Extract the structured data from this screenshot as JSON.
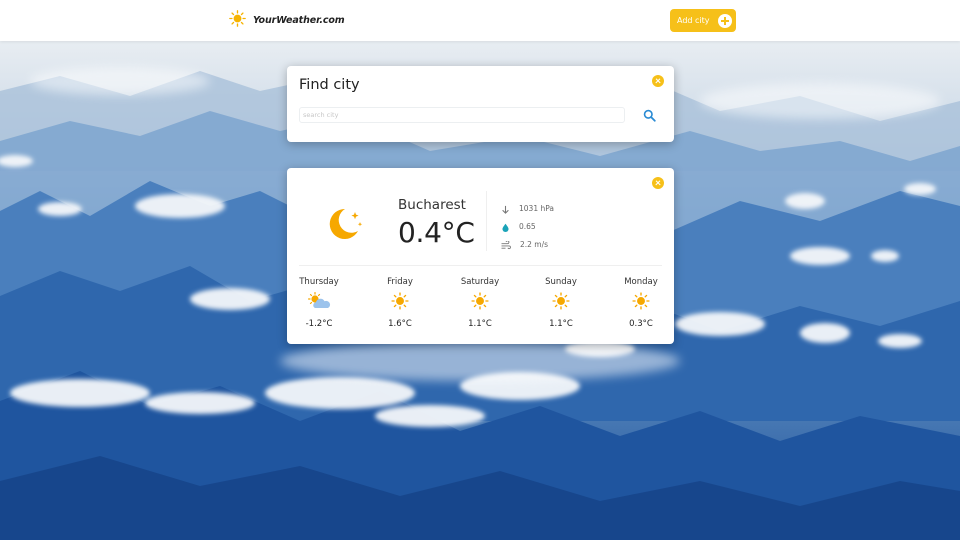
{
  "header": {
    "brand": "YourWeather.com",
    "add_city_label": "Add city",
    "brand_icon": "sun-icon"
  },
  "find_city": {
    "title": "Find city",
    "search_placeholder": "search city",
    "search_value": ""
  },
  "weather": {
    "city": "Bucharest",
    "temperature": "0.4°C",
    "condition_icon": "moon-stars-icon",
    "pressure": "1031 hPa",
    "humidity": "0.65",
    "wind": "2.2 m/s",
    "forecast": [
      {
        "day": "Thursday",
        "icon": "sun-cloud-icon",
        "temp": "-1.2°C"
      },
      {
        "day": "Friday",
        "icon": "sun-icon",
        "temp": "1.6°C"
      },
      {
        "day": "Saturday",
        "icon": "sun-icon",
        "temp": "1.1°C"
      },
      {
        "day": "Sunday",
        "icon": "sun-icon",
        "temp": "1.1°C"
      },
      {
        "day": "Monday",
        "icon": "sun-icon",
        "temp": "0.3°C"
      }
    ]
  },
  "colors": {
    "accent": "#f6c019",
    "sun": "#f6a800",
    "search_icon": "#2a8bd4",
    "sky_top": "#e9eef3",
    "mountain": "#1e5aa8"
  }
}
